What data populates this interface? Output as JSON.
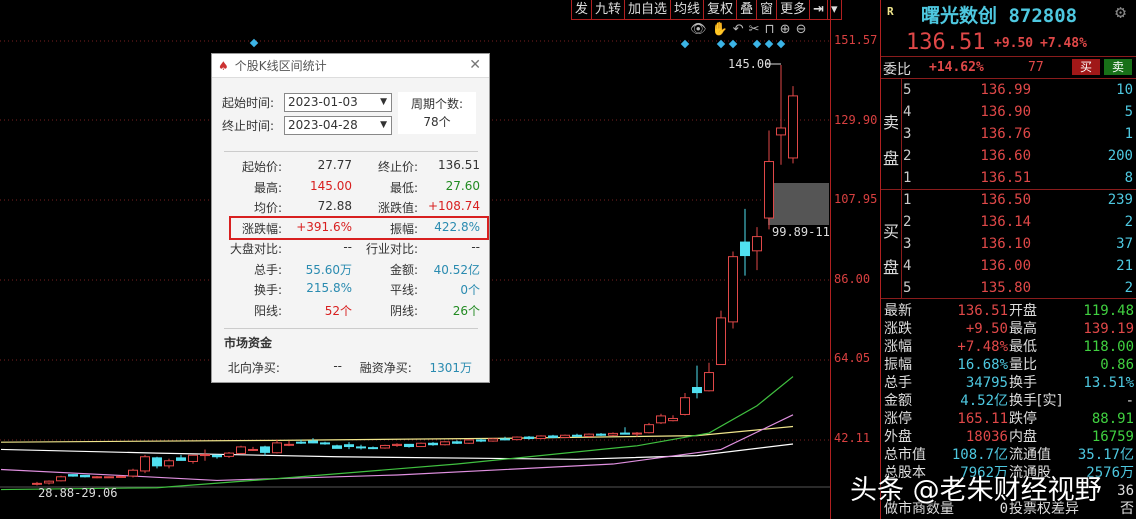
{
  "toolbar": {
    "items": [
      "发",
      "九转",
      "加自选",
      "均线",
      "复权",
      "叠",
      "窗",
      "更多"
    ],
    "exit_icon": "⇥",
    "dropdown_icon": "▾"
  },
  "chart_icons": [
    "eye-icon",
    "hand-icon",
    "undo-icon",
    "scissors-icon",
    "lock-icon",
    "zoom-in-icon",
    "zoom-out-icon"
  ],
  "chart_data": {
    "type": "candlestick",
    "y_axis_labels": [
      "151.57",
      "129.90",
      "107.95",
      "86.00",
      "64.05",
      "42.11"
    ],
    "y_axis_values": [
      151.57,
      129.9,
      107.95,
      86.0,
      64.05,
      42.11
    ],
    "high_label": "145.00",
    "low_label": "28.88-29.06",
    "selection_label": "99.89-11",
    "ohlc": [
      [
        30.0,
        30.6,
        29.6,
        30.2
      ],
      [
        30.3,
        31.0,
        29.9,
        30.8
      ],
      [
        30.9,
        32.3,
        30.7,
        32.0
      ],
      [
        32.6,
        32.7,
        32.0,
        32.2
      ],
      [
        32.4,
        32.5,
        31.8,
        32.0
      ],
      [
        31.9,
        32.2,
        31.6,
        32.0
      ],
      [
        31.9,
        32.1,
        31.7,
        32.0
      ],
      [
        32.0,
        32.3,
        31.8,
        32.1
      ],
      [
        32.2,
        34.2,
        31.8,
        33.8
      ],
      [
        33.6,
        38.0,
        33.0,
        37.5
      ],
      [
        37.2,
        37.5,
        34.3,
        35.0
      ],
      [
        35.0,
        37.0,
        34.3,
        36.4
      ],
      [
        37.2,
        38.0,
        36.5,
        36.5
      ],
      [
        36.2,
        38.0,
        35.6,
        37.9
      ],
      [
        38.0,
        39.5,
        36.4,
        38.1
      ],
      [
        37.9,
        38.1,
        37.0,
        37.5
      ],
      [
        37.6,
        38.8,
        37.2,
        38.5
      ],
      [
        38.4,
        40.5,
        38.2,
        40.2
      ],
      [
        39.5,
        40.2,
        39.1,
        39.5
      ],
      [
        40.2,
        40.5,
        37.8,
        38.7
      ],
      [
        38.6,
        42.2,
        38.4,
        41.3
      ],
      [
        40.9,
        41.9,
        40.4,
        40.9
      ],
      [
        41.5,
        42.2,
        41.0,
        41.3
      ],
      [
        41.8,
        42.6,
        41.2,
        41.3
      ],
      [
        41.3,
        41.6,
        40.8,
        41.2
      ],
      [
        40.5,
        40.8,
        40.1,
        39.8
      ],
      [
        40.8,
        41.5,
        39.6,
        40.3
      ],
      [
        40.2,
        40.8,
        39.5,
        40.0
      ],
      [
        40.0,
        40.3,
        39.6,
        39.9
      ],
      [
        39.9,
        40.8,
        39.7,
        40.6
      ],
      [
        40.6,
        41.2,
        40.2,
        40.9
      ],
      [
        40.9,
        41.0,
        40.0,
        40.3
      ],
      [
        40.3,
        41.4,
        40.2,
        41.2
      ],
      [
        41.2,
        41.5,
        40.5,
        40.8
      ],
      [
        40.8,
        41.8,
        40.6,
        41.6
      ],
      [
        41.6,
        42.0,
        41.0,
        41.2
      ],
      [
        41.2,
        42.3,
        41.0,
        42.1
      ],
      [
        42.1,
        42.5,
        41.5,
        41.8
      ],
      [
        41.8,
        42.6,
        41.6,
        42.4
      ],
      [
        42.4,
        43.0,
        42.0,
        42.2
      ],
      [
        42.2,
        43.1,
        42.0,
        42.9
      ],
      [
        42.9,
        43.2,
        42.2,
        42.5
      ],
      [
        42.5,
        43.4,
        42.3,
        43.2
      ],
      [
        43.2,
        43.5,
        42.6,
        42.8
      ],
      [
        42.8,
        43.6,
        42.6,
        43.4
      ],
      [
        43.4,
        43.8,
        42.9,
        43.1
      ],
      [
        43.1,
        43.9,
        42.9,
        43.7
      ],
      [
        43.7,
        44.0,
        43.2,
        43.4
      ],
      [
        43.4,
        44.2,
        43.2,
        43.9
      ],
      [
        44.0,
        45.6,
        43.6,
        43.7
      ],
      [
        43.8,
        44.3,
        43.0,
        44.0
      ],
      [
        44.1,
        46.8,
        43.9,
        46.3
      ],
      [
        46.8,
        49.3,
        46.5,
        48.7
      ],
      [
        47.4,
        48.9,
        47.2,
        48.0
      ],
      [
        49.1,
        55.0,
        48.8,
        53.7
      ],
      [
        56.5,
        62.5,
        53.5,
        55.1
      ],
      [
        55.6,
        63.3,
        55.4,
        60.6
      ],
      [
        62.8,
        77.6,
        62.8,
        75.6
      ],
      [
        74.5,
        93.8,
        72.7,
        92.4
      ],
      [
        96.4,
        105.5,
        87.2,
        92.7
      ],
      [
        94.0,
        100.5,
        88.7,
        97.9
      ],
      [
        103.0,
        127.0,
        99.89,
        118.5
      ],
      [
        125.8,
        145.0,
        117.6,
        127.7
      ],
      [
        119.48,
        139.19,
        118.0,
        136.51
      ]
    ],
    "ma_series": [
      {
        "name": "MA-yellow",
        "color": "#f0e68c",
        "points": [
          [
            -3,
            41.5
          ],
          [
            20,
            42.0
          ],
          [
            40,
            42.6
          ],
          [
            55,
            43.3
          ],
          [
            63,
            45.8
          ]
        ]
      },
      {
        "name": "MA-white",
        "color": "#ffffff",
        "points": [
          [
            -3,
            39.5
          ],
          [
            10,
            38.5
          ],
          [
            25,
            37.5
          ],
          [
            45,
            36.8
          ],
          [
            55,
            37.8
          ],
          [
            63,
            41.0
          ]
        ]
      },
      {
        "name": "MA-pink",
        "color": "#e090e0",
        "points": [
          [
            -3,
            34.0
          ],
          [
            8,
            32.2
          ],
          [
            15,
            31.0
          ],
          [
            30,
            32.5
          ],
          [
            48,
            35.5
          ],
          [
            57,
            39.5
          ],
          [
            63,
            49.0
          ]
        ]
      },
      {
        "name": "MA-green",
        "color": "#40c040",
        "points": [
          [
            -3,
            28.5
          ],
          [
            10,
            29.0
          ],
          [
            20,
            31.5
          ],
          [
            35,
            35.5
          ],
          [
            50,
            40.5
          ],
          [
            56,
            44.0
          ],
          [
            60,
            51.5
          ],
          [
            63,
            59.5
          ]
        ]
      }
    ]
  },
  "dialog": {
    "title": "个股K线区间统计",
    "start_label": "起始时间:",
    "start_value": "2023-01-03",
    "end_label": "终止时间:",
    "end_value": "2023-04-28",
    "period_label": "周期个数:",
    "period_value": "78个",
    "rows": [
      {
        "l1": "起始价:",
        "v1": "27.77",
        "c1": "",
        "l2": "终止价:",
        "v2": "136.51",
        "c2": ""
      },
      {
        "l1": "最高:",
        "v1": "145.00",
        "c1": "red",
        "l2": "最低:",
        "v2": "27.60",
        "c2": "grn"
      },
      {
        "l1": "均价:",
        "v1": "72.88",
        "c1": "",
        "l2": "涨跌值:",
        "v2": "+108.74",
        "c2": "red"
      },
      {
        "l1": "涨跌幅:",
        "v1": "+391.6%",
        "c1": "red",
        "l2": "振幅:",
        "v2": "422.8%",
        "c2": "blu"
      },
      {
        "l1": "大盘对比:",
        "v1": "--",
        "c1": "",
        "l2": "行业对比:",
        "v2": "--",
        "c2": ""
      },
      {
        "l1": "总手:",
        "v1": "55.60万",
        "c1": "blu",
        "l2": "金额:",
        "v2": "40.52亿",
        "c2": "blu"
      },
      {
        "l1": "换手:",
        "v1": "215.8%",
        "c1": "blu",
        "l2": "平线:",
        "v2": "0个",
        "c2": "blu"
      },
      {
        "l1": "阳线:",
        "v1": "52个",
        "c1": "red",
        "l2": "阴线:",
        "v2": "26个",
        "c2": "grn"
      }
    ],
    "fund_title": "市场资金",
    "north_label": "北向净买:",
    "north_value": "--",
    "margin_label": "融资净买:",
    "margin_value": "1301万"
  },
  "quote": {
    "badge": "R",
    "name": "曙光数创 872808",
    "price": "136.51",
    "change": "+9.50",
    "change_pct": "+7.48%",
    "weibi_label": "委比",
    "weibi_value": "+14.62%",
    "weicha": "77",
    "buy_label": "买",
    "sell_label": "卖",
    "sell_side_label": [
      "卖",
      "盘"
    ],
    "buy_side_label": [
      "买",
      "盘"
    ],
    "asks": [
      {
        "n": "5",
        "p": "136.99",
        "q": "10"
      },
      {
        "n": "4",
        "p": "136.90",
        "q": "5"
      },
      {
        "n": "3",
        "p": "136.76",
        "q": "1"
      },
      {
        "n": "2",
        "p": "136.60",
        "q": "200"
      },
      {
        "n": "1",
        "p": "136.51",
        "q": "8"
      }
    ],
    "bids": [
      {
        "n": "1",
        "p": "136.50",
        "q": "239"
      },
      {
        "n": "2",
        "p": "136.14",
        "q": "2"
      },
      {
        "n": "3",
        "p": "136.10",
        "q": "37"
      },
      {
        "n": "4",
        "p": "136.00",
        "q": "21"
      },
      {
        "n": "5",
        "p": "135.80",
        "q": "2"
      }
    ],
    "stats": [
      {
        "a": "最新",
        "b": "136.51",
        "bc": "cR",
        "c": "开盘",
        "d": "119.48",
        "dc": "cG"
      },
      {
        "a": "涨跌",
        "b": "+9.50",
        "bc": "cR",
        "c": "最高",
        "d": "139.19",
        "dc": "cR"
      },
      {
        "a": "涨幅",
        "b": "+7.48%",
        "bc": "cR",
        "c": "最低",
        "d": "118.00",
        "dc": "cG"
      },
      {
        "a": "振幅",
        "b": "16.68%",
        "bc": "cC",
        "c": "量比",
        "d": "0.86",
        "dc": "cG"
      },
      {
        "a": "总手",
        "b": "34795",
        "bc": "cC",
        "c": "换手",
        "d": "13.51%",
        "dc": "cC"
      },
      {
        "a": "金额",
        "b": "4.52亿",
        "bc": "cC",
        "c": "换手[实]",
        "d": "-",
        "dc": "cW"
      },
      {
        "a": "涨停",
        "b": "165.11",
        "bc": "cR",
        "c": "跌停",
        "d": "88.91",
        "dc": "cG"
      },
      {
        "a": "外盘",
        "b": "18036",
        "bc": "cR",
        "c": "内盘",
        "d": "16759",
        "dc": "cG"
      },
      {
        "a": "总市值",
        "b": "108.7亿",
        "bc": "cC",
        "c": "流通值",
        "d": "35.17亿",
        "dc": "cC"
      },
      {
        "a": "总股本",
        "b": "7962万",
        "bc": "cC",
        "c": "流通股",
        "d": "2576万",
        "dc": "cC"
      },
      {
        "a": "",
        "b": "",
        "bc": "cW",
        "c": "",
        "d": "36",
        "dc": "cW"
      },
      {
        "a": "做市商数量",
        "b": "0",
        "bc": "cW",
        "c": "投票权差异",
        "d": "否",
        "dc": "cW"
      }
    ]
  },
  "watermark": "头条 @老朱财经视野"
}
